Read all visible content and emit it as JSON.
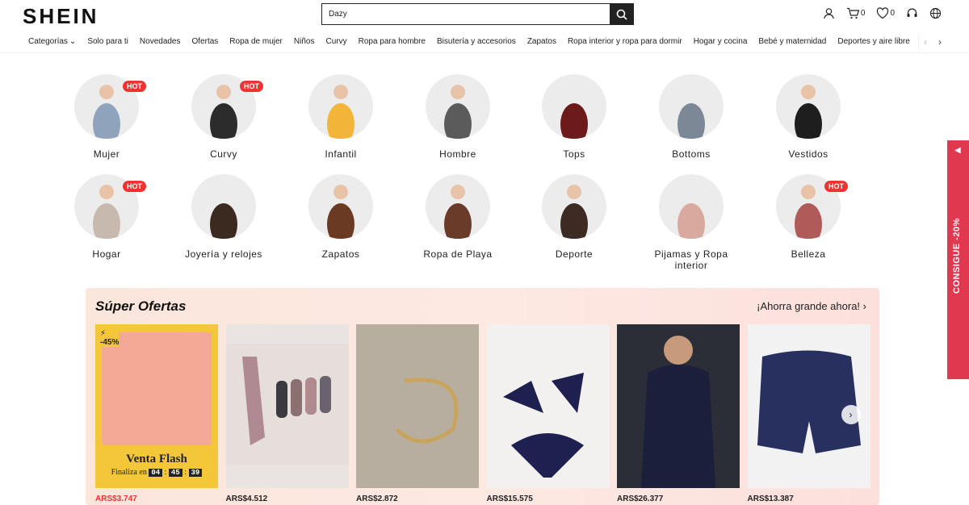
{
  "header": {
    "logo": "SHEIN",
    "search": {
      "value": "Dazy"
    },
    "cart_count": "0",
    "wishlist_count": "0"
  },
  "nav": {
    "items": [
      "Categorías",
      "Solo para ti",
      "Novedades",
      "Ofertas",
      "Ropa de mujer",
      "Niños",
      "Curvy",
      "Ropa para hombre",
      "Bisutería y accesorios",
      "Zapatos",
      "Ropa interior y ropa para dormir",
      "Hogar y cocina",
      "Bebé y maternidad",
      "Deportes y aire libre"
    ]
  },
  "categories": [
    {
      "label": "Mujer",
      "hot": "HOT"
    },
    {
      "label": "Curvy",
      "hot": "HOT"
    },
    {
      "label": "Infantil"
    },
    {
      "label": "Hombre"
    },
    {
      "label": "Tops"
    },
    {
      "label": "Bottoms"
    },
    {
      "label": "Vestidos"
    },
    {
      "label": "Hogar",
      "hot": "HOT"
    },
    {
      "label": "Joyería y relojes"
    },
    {
      "label": "Zapatos"
    },
    {
      "label": "Ropa de Playa"
    },
    {
      "label": "Deporte"
    },
    {
      "label": "Pijamas y Ropa interior"
    },
    {
      "label": "Belleza",
      "hot": "HOT"
    }
  ],
  "offers": {
    "title": "Súper Ofertas",
    "more": "¡Ahorra grande ahora!",
    "flash": {
      "discount": "-45%",
      "title": "Venta Flash",
      "ends_label": "Finaliza en",
      "h": "04",
      "m": "45",
      "s": "39"
    },
    "products": [
      {
        "price": "ARS$3.747"
      },
      {
        "price": "ARS$4.512"
      },
      {
        "price": "ARS$2.872"
      },
      {
        "price": "ARS$15.575"
      },
      {
        "price": "ARS$26.377"
      },
      {
        "price": "ARS$13.387"
      }
    ]
  },
  "side_tab": {
    "label": "CONSIGUE -20%"
  },
  "colors": {
    "accent": "#e33333",
    "side": "#e0384e"
  }
}
